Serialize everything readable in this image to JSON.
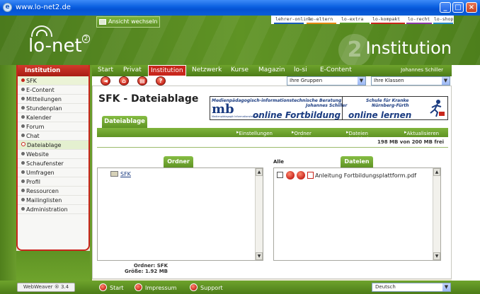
{
  "window": {
    "title": "www.lo-net2.de"
  },
  "header": {
    "logo_text": "lo-net",
    "logo_sup": "2",
    "section_title": "Institution",
    "ansicht_button": "Ansicht wechseln",
    "portal_links": [
      "lehrer-online",
      "lo-eltern",
      "lo-extra",
      "lo-kompakt",
      "lo-recht",
      "lo-shop"
    ],
    "portal_colors": [
      "#1a5bb8",
      "#e58a12",
      "#5a9a2a",
      "#c8261c",
      "#8a3aa8",
      "#2a8ac8"
    ]
  },
  "nav": {
    "items": [
      "Start",
      "Privat",
      "Institution",
      "Netzwerk",
      "Kurse",
      "Magazin",
      "lo-si",
      "E-Content"
    ],
    "active": "Institution",
    "user": "Johannes Schiller"
  },
  "toolbar": {
    "groups_select": "Ihre Gruppen",
    "classes_select": "Ihre Klassen"
  },
  "sidebar": {
    "title": "Institution",
    "items": [
      {
        "label": "SFK"
      },
      {
        "label": "E-Content"
      },
      {
        "label": "Mitteilungen"
      },
      {
        "label": "Stundenplan"
      },
      {
        "label": "Kalender"
      },
      {
        "label": "Forum"
      },
      {
        "label": "Chat"
      },
      {
        "label": "Dateiablage"
      },
      {
        "label": "Website"
      },
      {
        "label": "Schaufenster"
      },
      {
        "label": "Umfragen"
      },
      {
        "label": "Profil"
      },
      {
        "label": "Ressourcen"
      },
      {
        "label": "Mailinglisten"
      },
      {
        "label": "Administration"
      }
    ]
  },
  "main": {
    "title": "SFK - Dateiablage",
    "tab": "Dateiablage",
    "banner": {
      "line1": "Medienpädagogisch-informationstechnische Beratung",
      "line2": "Johannes Schiller",
      "line3": "online Fortbildung",
      "mb": "mb",
      "mb_sub": "Medienpädagogik Informationstechnik",
      "line4": "Schule für Kranke",
      "line5": "Nürnberg-Fürth",
      "line6": "online lernen"
    },
    "actions": [
      "Einstellungen",
      "Ordner anlegen",
      "Dateien hochladen",
      "Aktualisieren"
    ],
    "quota": "198 MB von 200 MB frei",
    "ordner_panel": {
      "title": "Ordner",
      "folder": "SFK",
      "footer_ordner_label": "Ordner:",
      "footer_ordner_value": "SFK",
      "footer_groesse_label": "Größe:",
      "footer_groesse_value": "1.92 MB"
    },
    "dateien_panel": {
      "title": "Dateien",
      "alle_label": "Alle",
      "file": "Anleitung Fortbildungsplattform.pdf"
    }
  },
  "statusbar": {
    "version": "WebWeaver ® 3.4",
    "start": "Start",
    "impressum": "Impressum",
    "support": "Support",
    "language": "Deutsch"
  }
}
